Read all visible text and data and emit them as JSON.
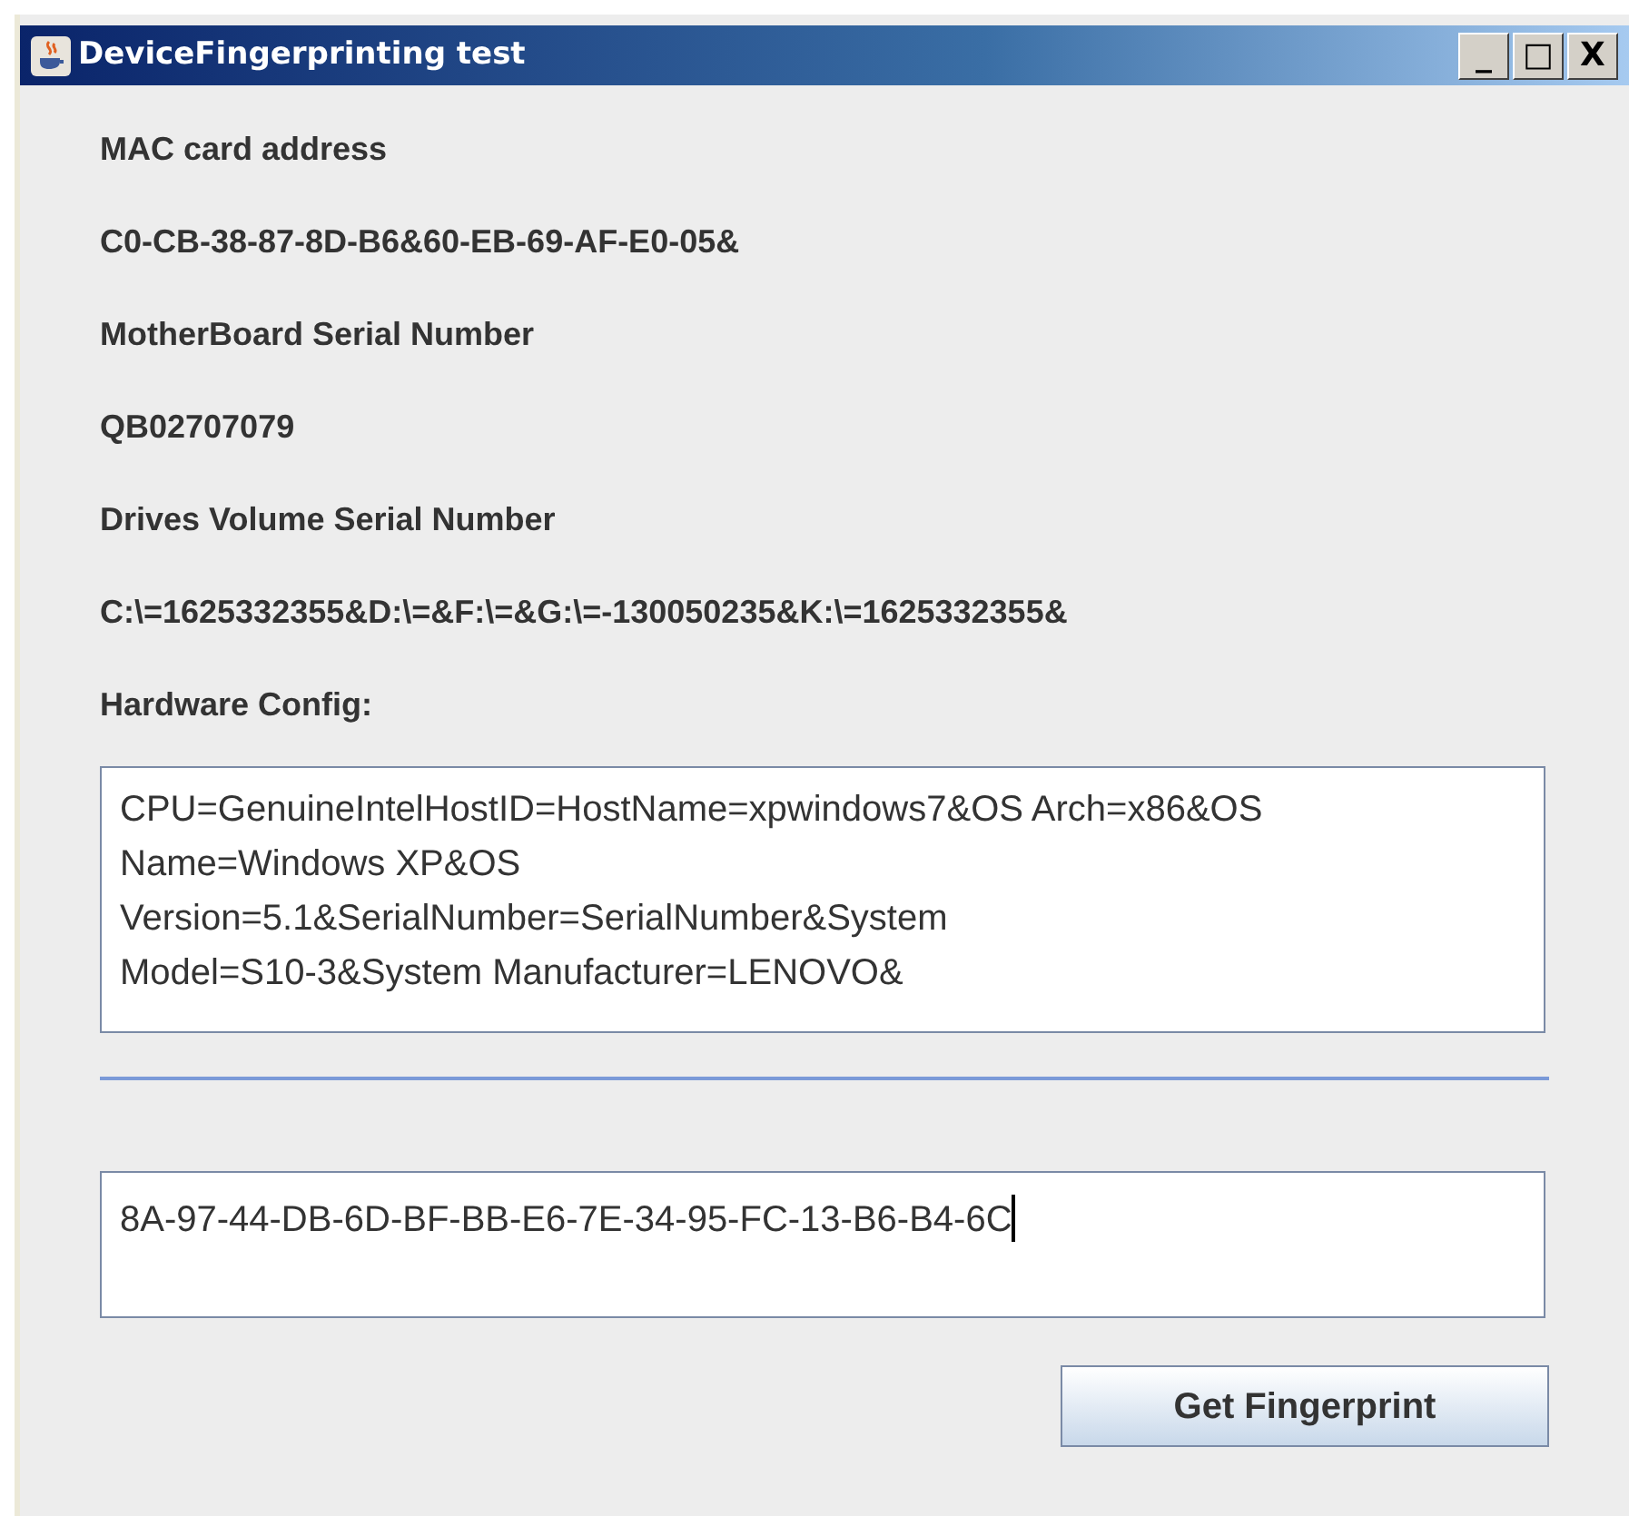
{
  "window": {
    "title": "DeviceFingerprinting test",
    "controls": [
      "_",
      "□",
      "X"
    ]
  },
  "fields": [
    {
      "label": "MAC card address",
      "value": "C0-CB-38-87-8D-B6&60-EB-69-AF-E0-05&"
    },
    {
      "label": "MotherBoard Serial Number",
      "value": "QB02707079"
    },
    {
      "label": "Drives Volume Serial Number",
      "value": "C:\\=1625332355&D:\\=&F:\\=&G:\\=-130050235&K:\\=1625332355&"
    }
  ],
  "hardware_config": {
    "label": "Hardware Config:",
    "lines": [
      "CPU=GenuineIntelHostID=HostName=xpwindows7&OS Arch=x86&OS",
      "Name=Windows XP&OS",
      "Version=5.1&SerialNumber=SerialNumber&System",
      "Model=S10-3&System Manufacturer=LENOVO&"
    ]
  },
  "fingerprint": {
    "value": "8A-97-44-DB-6D-BF-BB-E6-7E-34-95-FC-13-B6-B4-6C",
    "focused": true
  },
  "button": "Get Fingerprint"
}
